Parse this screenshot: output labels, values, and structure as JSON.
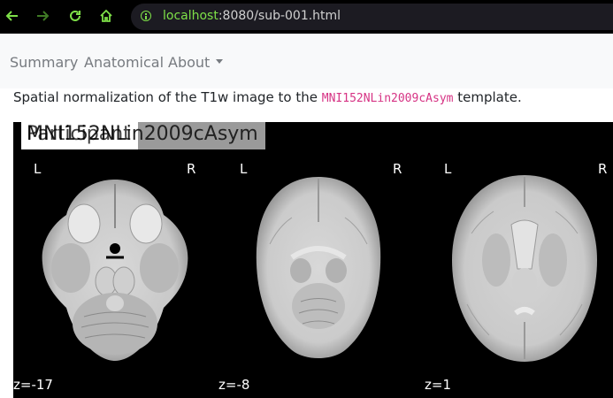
{
  "browser": {
    "url_host": "localhost",
    "url_rest": ":8080/sub-001.html",
    "accent": "#7ee048"
  },
  "navbar": {
    "items": [
      {
        "label": "Summary"
      },
      {
        "label": "Anatomical"
      },
      {
        "label": "About"
      }
    ]
  },
  "description": {
    "prefix": "Spatial normalization of the T1w image to the ",
    "template": "MNI152NLin2009cAsym",
    "suffix": " template."
  },
  "figure": {
    "overlay_label_back": "MNI152NLin2009cAsym",
    "overlay_label_front": "Participant",
    "slices": [
      {
        "left": "L",
        "right": "R",
        "z": "z=-17"
      },
      {
        "left": "L",
        "right": "R",
        "z": "z=-8"
      },
      {
        "left": "L",
        "right": "R",
        "z": "z=1"
      }
    ]
  }
}
